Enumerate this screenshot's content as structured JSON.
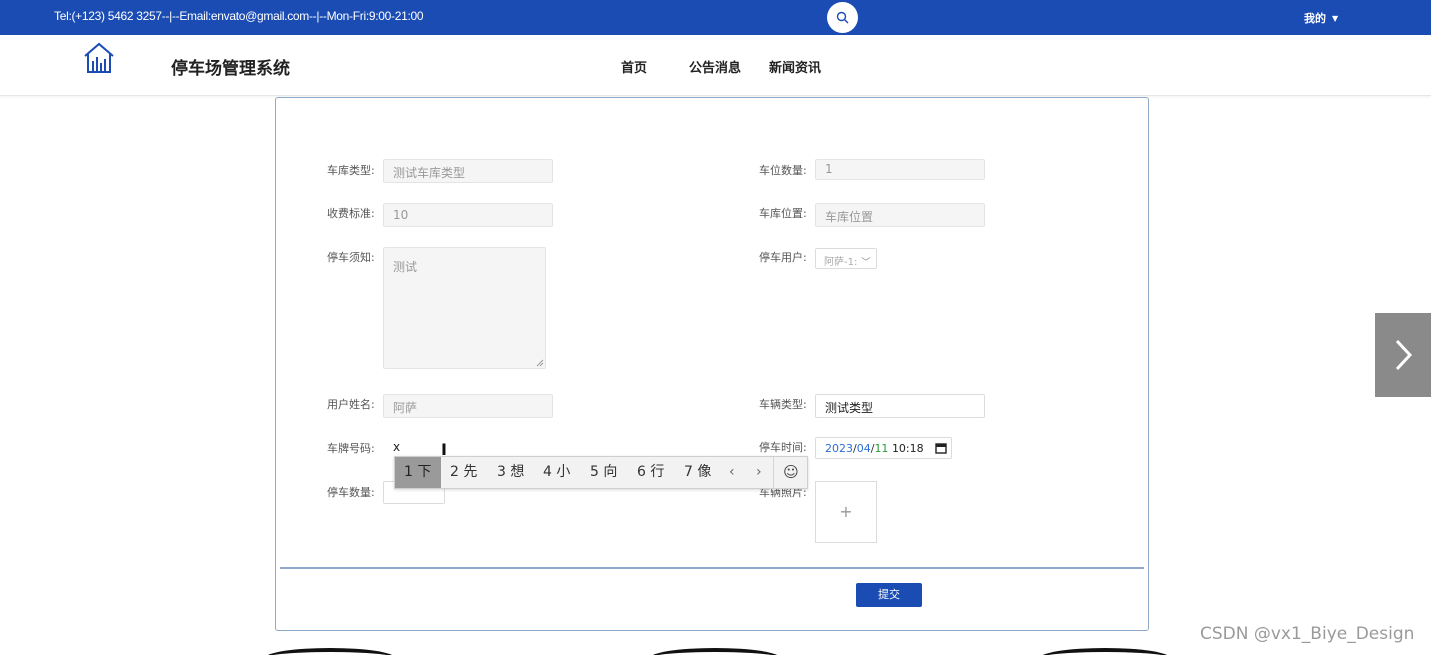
{
  "topbar": {
    "contact": "Tel:(+123) 5462 3257--|--Email:envato@gmail.com--|--Mon-Fri:9:00-21:00",
    "user_menu": "我的"
  },
  "header": {
    "site_title": "停车场管理系统",
    "nav": [
      "首页",
      "公告消息",
      "新闻资讯"
    ]
  },
  "form": {
    "garage_type": {
      "label": "车库类型:",
      "value": "测试车库类型"
    },
    "spot_count": {
      "label": "车位数量:",
      "value": "1"
    },
    "fee_standard": {
      "label": "收费标准:",
      "value": "10"
    },
    "garage_location": {
      "label": "车库位置:",
      "value": "车库位置"
    },
    "parking_notice": {
      "label": "停车须知:",
      "value": "测试"
    },
    "parking_user": {
      "label": "停车用户:",
      "value": "阿萨-1:"
    },
    "user_name": {
      "label": "用户姓名:",
      "value": "阿萨"
    },
    "vehicle_type": {
      "label": "车辆类型:",
      "value": "测试类型"
    },
    "plate_number": {
      "label": "车牌号码:",
      "value": "x"
    },
    "parking_time": {
      "label": "停车时间:",
      "year": "2023",
      "month": "04",
      "day": "11",
      "time": "10:18"
    },
    "parking_quantity": {
      "label": "停车数量:"
    },
    "vehicle_photo": {
      "label": "车辆照片:",
      "plus": "+"
    },
    "submit_label": "提交"
  },
  "ime": {
    "candidates": [
      {
        "num": "1",
        "char": "下"
      },
      {
        "num": "2",
        "char": "先"
      },
      {
        "num": "3",
        "char": "想"
      },
      {
        "num": "4",
        "char": "小"
      },
      {
        "num": "5",
        "char": "向"
      },
      {
        "num": "6",
        "char": "行"
      },
      {
        "num": "7",
        "char": "像"
      }
    ],
    "prev": "‹",
    "next": "›",
    "emoji": "☺"
  },
  "watermark": "CSDN @vx1_Biye_Design",
  "colors": {
    "primary": "#1a4cb4",
    "card_border": "#8fa9cc"
  }
}
